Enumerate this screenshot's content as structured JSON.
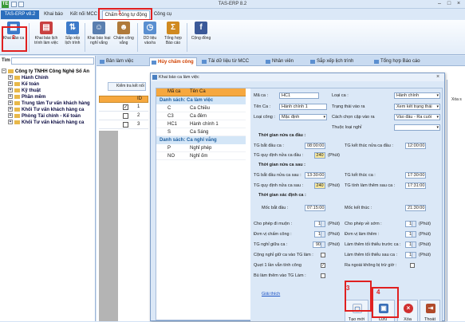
{
  "app": {
    "title": "TAS-ERP 8.2",
    "logo": "TE"
  },
  "tabs": {
    "file": "TAS-ERP v8.2",
    "items": [
      "Khai báo",
      "Kết nối MCC",
      "Chấm công tự động",
      "Công cụ"
    ]
  },
  "ribbon": {
    "buttons": [
      {
        "label": "Khai báo ca",
        "icon": "calendar-edit-icon",
        "color": "#3d7ac9"
      },
      {
        "label": "Khai báo lịch trình làm việc",
        "icon": "schedule-icon",
        "color": "#c94040"
      },
      {
        "label": "Sắp xếp lịch trình",
        "icon": "sort-schedule-icon",
        "color": "#3d7ac9"
      },
      {
        "label": "Khai báo loại nghỉ vắng",
        "icon": "user-leave-icon",
        "color": "#5a7fb0"
      },
      {
        "label": "Chấm công vắng",
        "icon": "user-absent-icon",
        "color": "#b07a3a"
      },
      {
        "label": "DD liệu vào/ra",
        "icon": "clock-icon",
        "color": "#5a8fd0"
      },
      {
        "label": "Tổng hợp Báo cáo",
        "icon": "sum-icon",
        "color": "#d08a20"
      },
      {
        "label": "Cộng đồng",
        "icon": "facebook-icon",
        "color": "#3b5998"
      }
    ]
  },
  "annotations": [
    "1",
    "2",
    "3",
    "4"
  ],
  "sidebar": {
    "search_label": "Tìm",
    "root": "Công ty TNHH Công Nghệ Số An",
    "nodes": [
      "Hành Chính",
      "Kế toán",
      "Kỹ thuật",
      "Phần mềm",
      "Trung tâm Tư vấn khách hàng",
      "Khối Tư vấn khách hàng ca",
      "Phòng Tài chính - Kế toán",
      "Khối Tư vấn khách hàng ca"
    ]
  },
  "doctabs": [
    "Bản làm việc",
    "Hủy chấm công",
    "Tải dữ liệu từ MCC",
    "Nhân viên",
    "Sắp xếp lịch trình",
    "Tổng hợp Báo cáo"
  ],
  "main": {
    "check_button": "Kiểm tra kết nối",
    "grid_header": "ID",
    "grid_ids": [
      "1",
      "2",
      "3"
    ],
    "right_label": "Xóa s"
  },
  "dialog": {
    "title": "Khai báo ca làm việc",
    "grid": {
      "col_code": "Mã ca",
      "col_name": "Tên Ca",
      "group_work": "Danh sách: Ca làm việc",
      "work_rows": [
        [
          "C",
          "Ca Chiều"
        ],
        [
          "C3",
          "Ca đêm"
        ],
        [
          "HC1",
          "Hành chính 1"
        ],
        [
          "S",
          "Ca Sáng"
        ]
      ],
      "group_leave": "Danh sách: Ca nghỉ vắng",
      "leave_rows": [
        [
          "P",
          "Nghỉ phép"
        ],
        [
          "NO",
          "Nghỉ ốm"
        ]
      ]
    },
    "form": {
      "ma_ca_label": "Mã ca :",
      "ma_ca": "HC1",
      "loai_ca_label": "Loại ca :",
      "loai_ca": "Hành chính",
      "ten_ca_label": "Tên Ca :",
      "ten_ca": "Hành chính 1",
      "trang_thai_label": "Trạng thái vào ra",
      "trang_thai": "Xem kết trạng thái",
      "cong_label": "Loại công :",
      "cong": "Mặc định",
      "cach_chon_label": "Cách chọn cặp vào ra",
      "cach_chon": "Vào đầu - Ra cuối",
      "thuoc_loai_label": "Thuộc loại nghỉ",
      "sec1": "Thời gian nửa ca đầu :",
      "tg_bat_dau_label": "TG bắt đầu ca :",
      "tg_bat_dau": "08:00:00",
      "tg_ket_thuc_1_label": "TG kết thúc nửa ca đầu :",
      "tg_ket_thuc_1": "12:00:00",
      "tg_quy_dinh_1_label": "TG quy định nửa ca đầu :",
      "tg_quy_dinh_1": "240",
      "phut": "(Phút)",
      "sec2": "Thời gian nửa ca sau :",
      "tg_bat_dau_2_label": "TG bắt đầu nửa ca sau :",
      "tg_bat_dau_2": "13:30:00",
      "tg_ket_thuc_ca_label": "TG kết thúc ca :",
      "tg_ket_thuc_ca": "17:30:00",
      "tg_quy_dinh_2_label": "TG quy định nửa ca sau :",
      "tg_quy_dinh_2": "240",
      "tg_tinh_them_label": "TG tính làm thêm sau ca :",
      "tg_tinh_them": "17:31:00",
      "sec3": "Thời gian xác định ca :",
      "moc_bat_dau_label": "Mốc bắt đầu :",
      "moc_bat_dau": "07:15:00",
      "moc_ket_thuc_label": "Mốc kết thúc :",
      "moc_ket_thuc": "21:30:00",
      "cho_phep_muon_label": "Cho phép đi muộn :",
      "cho_phep_muon": "1",
      "cho_phep_som_label": "Cho phép về sớm :",
      "cho_phep_som": "1",
      "don_vi_cong_label": "Đơn vị chấm công :",
      "don_vi_cong": "1",
      "don_vi_lam_them_label": "Đơn vị làm thêm :",
      "don_vi_lam_them": "1",
      "tg_nghi_giua_label": "TG nghỉ giữa ca :",
      "tg_nghi_giua": "90",
      "lam_them_truoc_label": "Làm thêm tối thiểu trước ca :",
      "lam_them_truoc": "1",
      "cong_nghi_label": "Cộng nghỉ giữ ca vào TG làm :",
      "lam_them_sau_label": "Làm thêm tối thiểu sau ca :",
      "lam_them_sau": "1",
      "quet_1_lan_label": "Quẹt 1 lần vẫn tính công",
      "ra_ngoai_label": "Ra ngoài không bị trừ giờ :",
      "bu_lam_them_label": "Bù làm thêm vào TG Làm :",
      "giai_thich": "Giải thích"
    },
    "buttons": {
      "new": "Tạo mới",
      "save": "Lưu",
      "delete": "Xóa",
      "exit": "Thoát"
    }
  }
}
